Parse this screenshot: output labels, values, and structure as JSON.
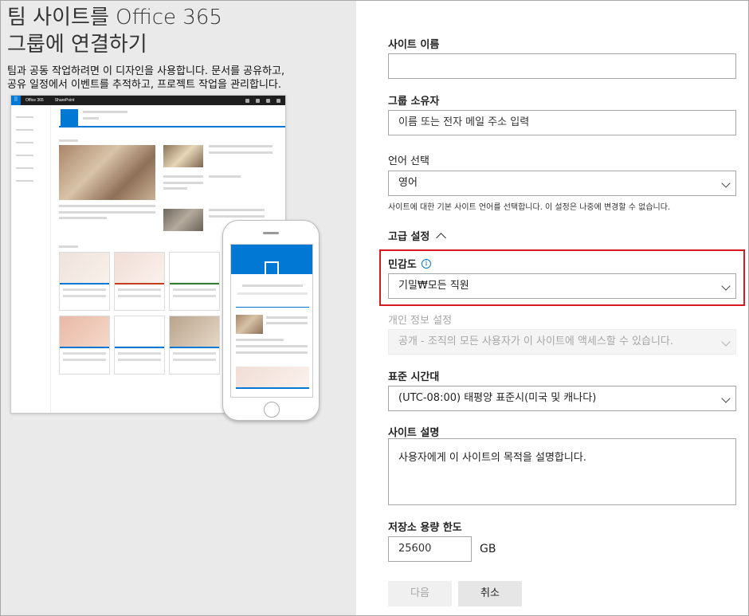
{
  "left": {
    "title_line1": "팀 사이트를 Office 365",
    "title_line2": "그룹에 연결하기",
    "desc_line1": "팀과 공동 작업하려면 이 디자인을 사용합니다. 문서를 공유하고,",
    "desc_line2": "공유 일정에서 이벤트를 추적하고, 프로젝트 작업을 관리합니다.",
    "preview": {
      "suite_app": "Office 365",
      "suite_sub": "SharePoint"
    }
  },
  "form": {
    "site_name": {
      "label": "사이트 이름",
      "value": ""
    },
    "group_owner": {
      "label": "그룹 소유자",
      "placeholder": "이름 또는 전자 메일 주소 입력"
    },
    "language": {
      "label": "언어 선택",
      "value": "영어",
      "hint": "사이트에 대한 기본 사이트 언어를 선택합니다. 이 설정은 나중에 변경할 수 없습니다."
    },
    "advanced": {
      "label": "고급 설정"
    },
    "sensitivity": {
      "label": "민감도",
      "info": "i",
      "value": "기밀₩모든 직원"
    },
    "privacy": {
      "label": "개인 정보 설정",
      "value": "공개 - 조직의 모든 사용자가 이 사이트에 액세스할 수 있습니다."
    },
    "timezone": {
      "label": "표준 시간대",
      "value": "(UTC-08:00) 태평양 표준시(미국 및 캐나다)"
    },
    "description": {
      "label": "사이트 설명",
      "placeholder": "사용자에게 이 사이트의 목적을 설명합니다."
    },
    "storage": {
      "label": "저장소 용량 한도",
      "value": "25600",
      "unit": "GB"
    },
    "buttons": {
      "next": "다음",
      "cancel": "취소"
    }
  },
  "colors": {
    "accent": "#0078d4",
    "highlight": "#d71920"
  }
}
